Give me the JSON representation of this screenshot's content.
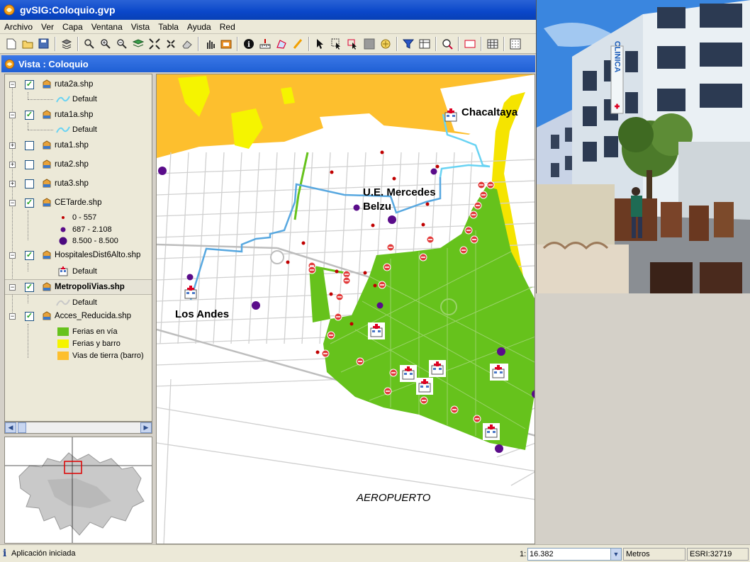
{
  "window": {
    "title": "gvSIG:Coloquio.gvp"
  },
  "menu": [
    "Archivo",
    "Ver",
    "Capa",
    "Ventana",
    "Vista",
    "Tabla",
    "Ayuda",
    "Red"
  ],
  "toolbar_icons": [
    "new-icon",
    "open-icon",
    "save-icon",
    "layers-icon",
    "zoom-full-icon",
    "zoom-in-icon",
    "zoom-out-icon",
    "layer-stack-icon",
    "zoom-extent-icon",
    "zoom-select-icon",
    "erase-icon",
    "pan-icon",
    "view-icon",
    "info-icon",
    "measure-icon",
    "area-icon",
    "hyperlink-icon",
    "select-icon",
    "select-rect-icon",
    "select-poly-icon",
    "gray-square-icon",
    "graphic-icon",
    "filter-icon",
    "table-icon",
    "find-icon",
    "rectangle-icon",
    "grid-icon",
    "dots-icon"
  ],
  "view": {
    "title": "Vista : Coloquio"
  },
  "toc": {
    "layers": [
      {
        "name": "ruta2a.shp",
        "expanded": true,
        "checked": true,
        "legend": [
          {
            "label": "Default",
            "symbol": "line-cyan"
          }
        ]
      },
      {
        "name": "ruta1a.shp",
        "expanded": true,
        "checked": true,
        "legend": [
          {
            "label": "Default",
            "symbol": "line-cyan"
          }
        ]
      },
      {
        "name": "ruta1.shp",
        "expanded": false,
        "checked": false,
        "legend": []
      },
      {
        "name": "ruta2.shp",
        "expanded": false,
        "checked": false,
        "legend": []
      },
      {
        "name": "ruta3.shp",
        "expanded": false,
        "checked": false,
        "legend": []
      },
      {
        "name": "CETarde.shp",
        "expanded": true,
        "checked": true,
        "legend": [
          {
            "label": "0 - 557",
            "symbol": "dot-red-small"
          },
          {
            "label": "687 - 2.108",
            "symbol": "dot-purple-medium"
          },
          {
            "label": "8.500 - 8.500",
            "symbol": "dot-purple-large"
          }
        ]
      },
      {
        "name": "HospitalesDist6Alto.shp",
        "expanded": true,
        "checked": true,
        "legend": [
          {
            "label": "Default",
            "symbol": "hospital"
          }
        ]
      },
      {
        "name": "MetropoliVias.shp",
        "expanded": true,
        "checked": true,
        "selected": true,
        "legend": [
          {
            "label": "Default",
            "symbol": "line-gray"
          }
        ]
      },
      {
        "name": "Acces_Reducida.shp",
        "expanded": true,
        "checked": true,
        "legend": [
          {
            "label": "Ferias en vía",
            "symbol": "fill-green"
          },
          {
            "label": "Ferias y barro",
            "symbol": "fill-yellow"
          },
          {
            "label": "Vias de tierra (barro)",
            "symbol": "fill-orange"
          }
        ]
      }
    ]
  },
  "map_labels": {
    "chacaltaya": "Chacaltaya",
    "mercedes_line1": "U.E. Mercedes",
    "mercedes_line2": "Belzu",
    "los_andes": "Los Andes",
    "aeropuerto": "AEROPUERTO"
  },
  "photo": {
    "sign_text": "CLINICA"
  },
  "status": {
    "message": "Aplicación iniciada",
    "scale_prefix": "1:",
    "scale_value": "16.382",
    "units": "Metros",
    "crs": "ESRI:32719"
  },
  "colors": {
    "title_blue": "#0a47c9",
    "green": "#66c21c",
    "yellow": "#f5f400",
    "orange": "#fdbf2e",
    "route_cyan": "#69d3f3",
    "route_blue": "#58a8e0",
    "purple": "#5a0c8a",
    "red_dot": "#c00000"
  }
}
